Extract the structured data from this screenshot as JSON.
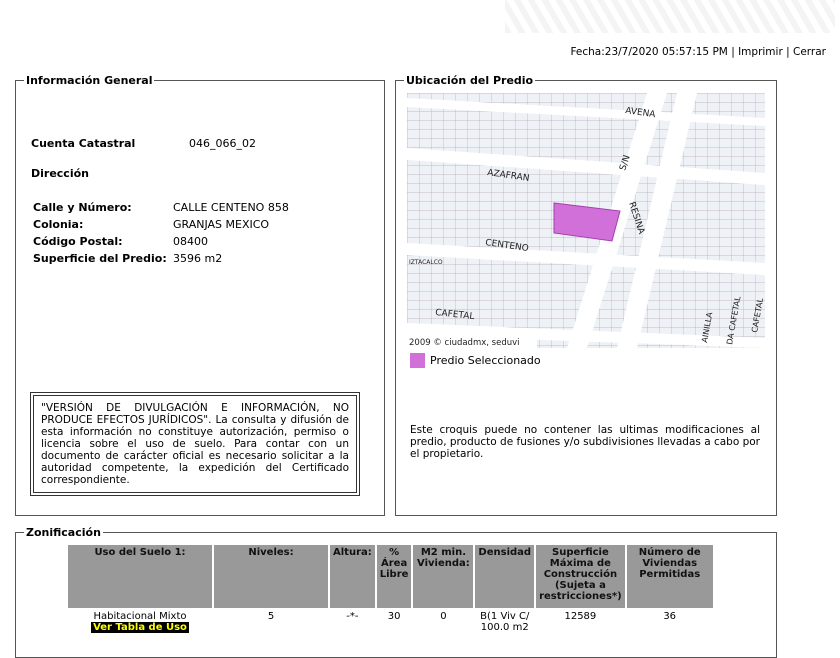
{
  "header": {
    "fecha": "Fecha:23/7/2020 05:57:15 PM",
    "imprimir": "Imprimir",
    "cerrar": "Cerrar",
    "sep": "|"
  },
  "info": {
    "legend": "Información General",
    "cuenta_label": "Cuenta Catastral",
    "cuenta_value": "046_066_02",
    "direccion_label": "Dirección",
    "fields": [
      {
        "label": "Calle y Número:",
        "value": "CALLE CENTENO 858"
      },
      {
        "label": "Colonia:",
        "value": "GRANJAS MEXICO"
      },
      {
        "label": "Código Postal:",
        "value": "08400"
      },
      {
        "label": "Superficie del Predio:",
        "value": "3596 m2"
      }
    ],
    "notice": "\"VERSIÓN DE DIVULGACIÓN E INFORMACIÓN, NO PRODUCE EFECTOS JURÍDICOS\". La consulta y difusión de esta información no constituye autorización, permiso o licencia sobre el uso de suelo. Para contar con un documento de carácter oficial es necesario solicitar a la autoridad competente, la expedición del Certificado correspondiente."
  },
  "ubicacion": {
    "legend": "Ubicación del Predio",
    "streets": [
      "AVENA",
      "AZAFRAN",
      "S/N",
      "RESINA",
      "CENTENO",
      "IZTACALCO",
      "CAFETAL",
      "AINILLA",
      "DA CAFETAL",
      "CAFETAL"
    ],
    "copyright": "2009 © ciudadmx, seduvi",
    "legend_item": "Predio Seleccionado",
    "predio_color": "#d070d8",
    "note": "Este croquis puede no contener las ultimas modificaciones al predio, producto de fusiones y/o subdivisiones llevadas a cabo por el propietario."
  },
  "zonificacion": {
    "legend": "Zonificación",
    "headers": [
      "Uso del Suelo 1:",
      "Niveles:",
      "Altura:",
      "% Área Libre",
      "M2 min. Vivienda:",
      "Densidad",
      "Superficie Máxima de Construcción (Sujeta a restricciones*)",
      "Número de Viviendas Permitidas"
    ],
    "row": [
      "Habitacional Mixto",
      "5",
      "-*-",
      "30",
      "0",
      "B(1 Viv C/ 100.0 m2",
      "12589",
      "36"
    ],
    "ver_tabla": "Ver Tabla de Uso"
  }
}
